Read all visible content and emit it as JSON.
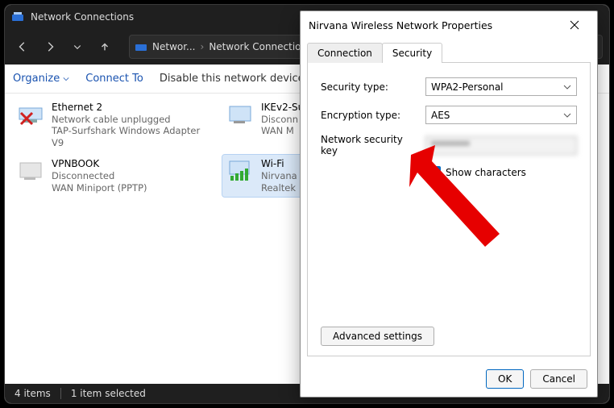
{
  "window": {
    "title": "Network Connections"
  },
  "breadcrumb": {
    "seg1": "Networ...",
    "seg2": "Network Connections"
  },
  "toolbar": {
    "organize": "Organize",
    "connect_to": "Connect To",
    "disable": "Disable this network device"
  },
  "adapters": [
    {
      "name": "Ethernet 2",
      "line2": "Network cable unplugged",
      "line3": "TAP-Surfshark Windows Adapter V9"
    },
    {
      "name": "IKEv2-Su",
      "line2": "Disconn",
      "line3": "WAN M"
    },
    {
      "name": "VPNBOOK",
      "line2": "Disconnected",
      "line3": "WAN Miniport (PPTP)"
    },
    {
      "name": "Wi-Fi",
      "line2": "Nirvana",
      "line3": "Realtek "
    }
  ],
  "status": {
    "count": "4 items",
    "selected": "1 item selected"
  },
  "dialog": {
    "title": "Nirvana Wireless Network Properties",
    "tabs": {
      "connection": "Connection",
      "security": "Security"
    },
    "fields": {
      "security_type_label": "Security type:",
      "security_type_value": "WPA2-Personal",
      "encryption_label": "Encryption type:",
      "encryption_value": "AES",
      "key_label": "Network security key",
      "key_value": "********"
    },
    "show_characters": "Show characters",
    "advanced": "Advanced settings",
    "ok": "OK",
    "cancel": "Cancel"
  }
}
